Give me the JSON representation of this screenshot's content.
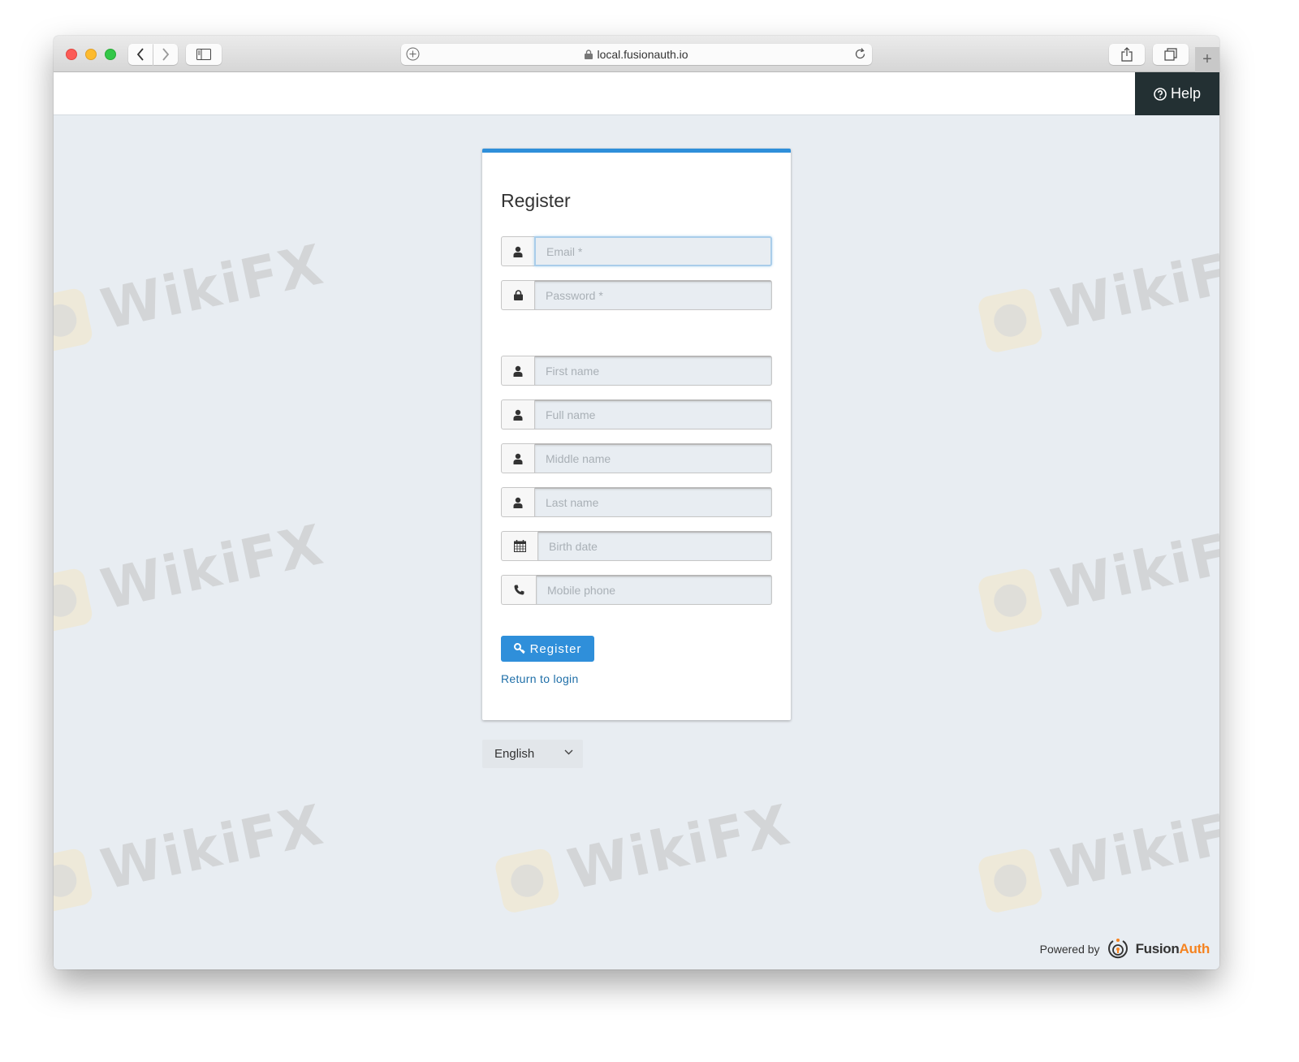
{
  "browser": {
    "url": "local.fusionauth.io",
    "icons": {
      "back": "chevron-left-icon",
      "forward": "chevron-right-icon",
      "sidebar": "sidebar-icon",
      "add": "plus-circle-icon",
      "lock": "lock-icon",
      "reload": "reload-icon",
      "share": "share-icon",
      "tabs": "tabs-icon",
      "new_tab": "plus-icon"
    }
  },
  "header": {
    "help_label": "Help",
    "help_icon": "question-circle-icon"
  },
  "form": {
    "title": "Register",
    "accent_color": "#2f8fda",
    "fields": [
      {
        "placeholder": "Email *",
        "icon": "user-icon",
        "value": ""
      },
      {
        "placeholder": "Password *",
        "icon": "lock-icon",
        "value": ""
      },
      {
        "placeholder": "First name",
        "icon": "user-icon",
        "value": ""
      },
      {
        "placeholder": "Full name",
        "icon": "user-icon",
        "value": ""
      },
      {
        "placeholder": "Middle name",
        "icon": "user-icon",
        "value": ""
      },
      {
        "placeholder": "Last name",
        "icon": "user-icon",
        "value": ""
      },
      {
        "placeholder": "Birth date",
        "icon": "calendar-icon",
        "value": ""
      },
      {
        "placeholder": "Mobile phone",
        "icon": "phone-icon",
        "value": ""
      }
    ],
    "submit_label": "Register",
    "submit_icon": "key-icon",
    "return_link": "Return to login"
  },
  "language": {
    "selected": "English"
  },
  "footer": {
    "powered_by": "Powered by",
    "brand_part1": "Fusion",
    "brand_part2": "Auth",
    "brand_color": "#f58320"
  },
  "watermark": {
    "text": "WikiFX"
  }
}
